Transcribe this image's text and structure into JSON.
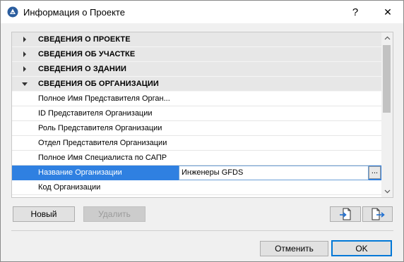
{
  "window": {
    "title": "Информация о Проекте",
    "help_symbol": "?",
    "close_symbol": "✕"
  },
  "table": {
    "sections": [
      {
        "label": "СВЕДЕНИЯ О ПРОЕКТЕ",
        "expanded": false
      },
      {
        "label": "СВЕДЕНИЯ ОБ УЧАСТКЕ",
        "expanded": false
      },
      {
        "label": "СВЕДЕНИЯ О ЗДАНИИ",
        "expanded": false
      },
      {
        "label": "СВЕДЕНИЯ ОБ ОРГАНИЗАЦИИ",
        "expanded": true
      }
    ],
    "fields": [
      {
        "label": "Полное Имя Представителя Орган..."
      },
      {
        "label": "ID Представителя Организации"
      },
      {
        "label": "Роль Представителя Организации"
      },
      {
        "label": "Отдел Представителя Организации"
      },
      {
        "label": "Полное Имя Специалиста по САПР"
      },
      {
        "label": "Название Организации",
        "value": "Инженеры GFDS",
        "selected": true
      },
      {
        "label": "Код Организации"
      }
    ],
    "ellipsis_label": "...",
    "selection_color": "#2f80e1"
  },
  "buttons": {
    "new_label": "Новый",
    "delete_label": "Удалить",
    "import_icon": "import-file-icon",
    "export_icon": "export-file-icon",
    "cancel_label": "Отменить",
    "ok_label": "OK"
  },
  "colors": {
    "accent": "#0078d7",
    "section_bg": "#e7e7e7"
  }
}
